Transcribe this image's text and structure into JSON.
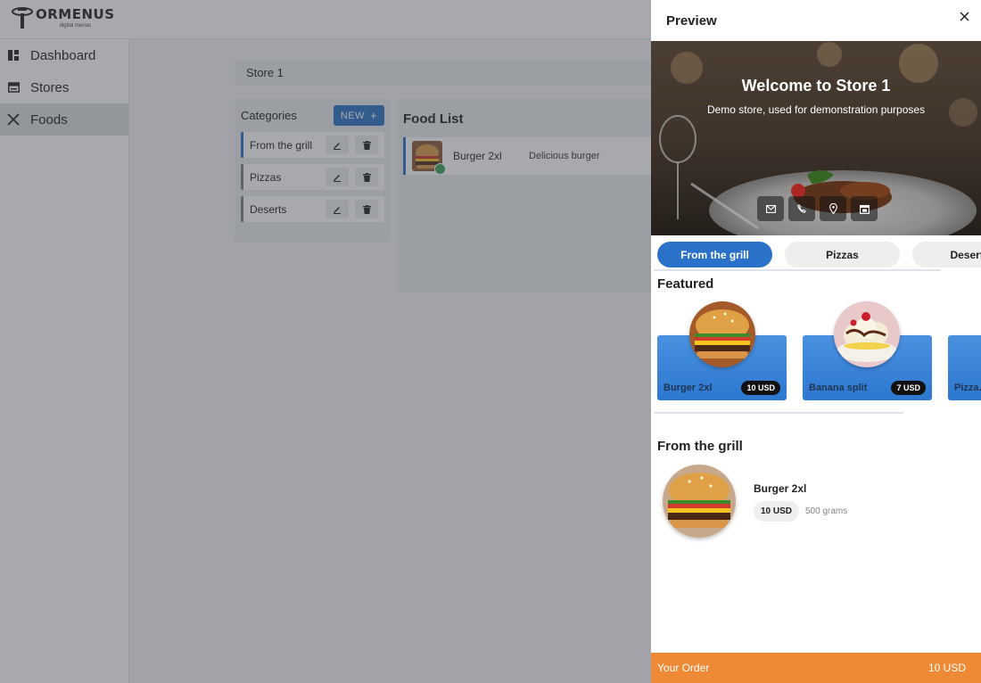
{
  "app": {
    "logo_title": "ORMENUS",
    "logo_sub": "digital menus"
  },
  "sidebar": {
    "items": [
      {
        "label": "Dashboard",
        "icon": "dashboard-icon"
      },
      {
        "label": "Stores",
        "icon": "store-icon"
      },
      {
        "label": "Foods",
        "icon": "utensils-icon",
        "active": true
      }
    ]
  },
  "breadcrumb": "Store 1",
  "categories": {
    "title": "Categories",
    "new_label": "NEW",
    "items": [
      {
        "label": "From the grill",
        "selected": true
      },
      {
        "label": "Pizzas"
      },
      {
        "label": "Deserts"
      }
    ]
  },
  "food_list": {
    "title": "Food List",
    "items": [
      {
        "name": "Burger 2xl",
        "description": "Delicious burger",
        "status": "active"
      }
    ]
  },
  "preview": {
    "title": "Preview",
    "hero_title": "Welcome to Store 1",
    "hero_subtitle": "Demo store, used for demonstration purposes",
    "hero_icons": [
      "mail-icon",
      "phone-icon",
      "location-icon",
      "calendar-icon"
    ],
    "tabs": [
      "From the grill",
      "Pizzas",
      "Deserts"
    ],
    "featured_title": "Featured",
    "featured": [
      {
        "name": "Burger 2xl",
        "price": "10 USD"
      },
      {
        "name": "Banana split",
        "price": "7 USD"
      },
      {
        "name": "Pizza...",
        "price": ""
      }
    ],
    "section_title": "From the grill",
    "items": [
      {
        "name": "Burger 2xl",
        "price": "10 USD",
        "weight": "500 grams"
      }
    ],
    "order_label": "Your Order",
    "order_total": "10 USD"
  },
  "colors": {
    "primary": "#2a72c9",
    "order_bar": "#ee8a35",
    "status_active": "#3aa55a"
  }
}
